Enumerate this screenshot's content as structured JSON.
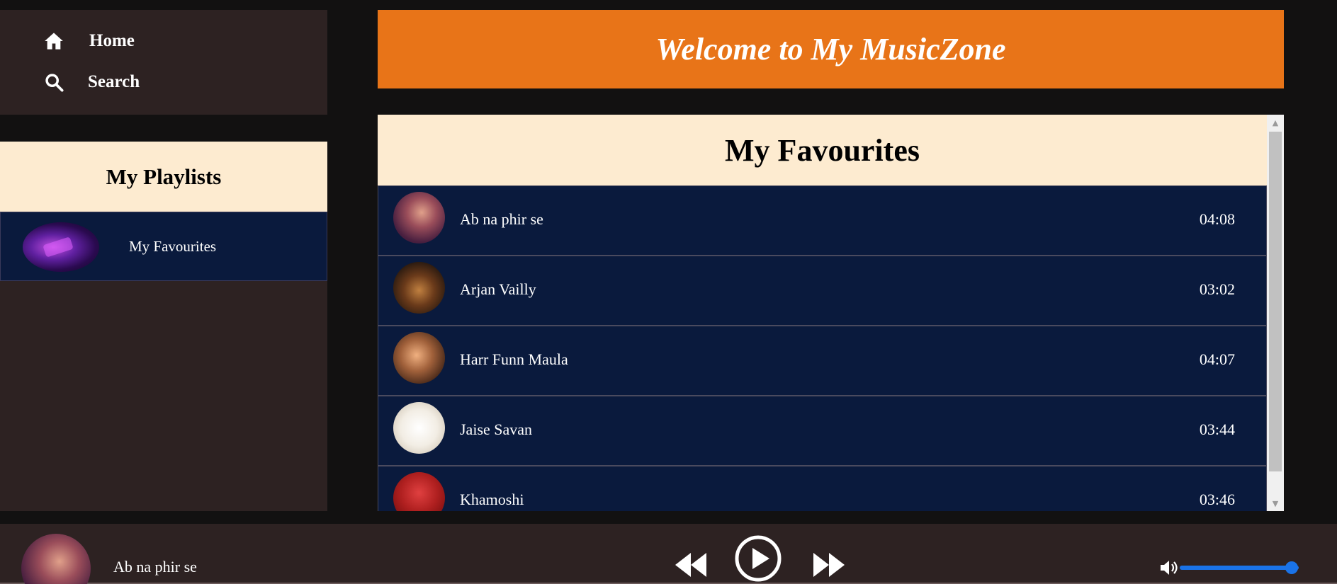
{
  "nav": {
    "items": [
      {
        "label": "Home",
        "icon": "home-icon"
      },
      {
        "label": "Search",
        "icon": "search-icon"
      }
    ]
  },
  "playlists": {
    "title": "My Playlists",
    "items": [
      {
        "label": "My Favourites"
      }
    ]
  },
  "banner": {
    "title": "Welcome to My MusicZone"
  },
  "favourites": {
    "title": "My Favourites",
    "songs": [
      {
        "title": "Ab na phir se",
        "duration": "04:08"
      },
      {
        "title": "Arjan Vailly",
        "duration": "03:02"
      },
      {
        "title": "Harr Funn Maula",
        "duration": "04:07"
      },
      {
        "title": "Jaise Savan",
        "duration": "03:44"
      },
      {
        "title": "Khamoshi",
        "duration": "03:46"
      }
    ]
  },
  "player": {
    "now_playing": "Ab na phir se",
    "volume": 1.0
  },
  "colors": {
    "accent": "#e87418",
    "panel": "#2d2222",
    "row": "#0a1a3d",
    "header": "#fdebd0",
    "slider": "#1a73e8"
  }
}
